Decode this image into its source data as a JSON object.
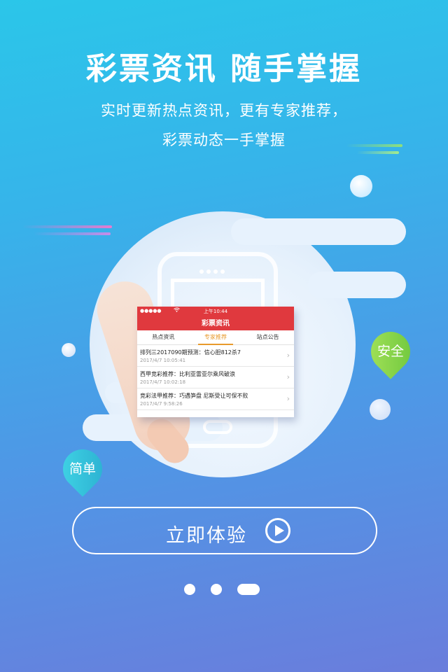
{
  "header": {
    "headline": "彩票资讯  随手掌握",
    "subtitle_line1": "实时更新热点资讯，更有专家推荐，",
    "subtitle_line2": "彩票动态一手掌握"
  },
  "mock_app": {
    "status_signal": "●●●●●",
    "status_wifi": "wifi-icon",
    "status_time": "上午10:44",
    "title": "彩票资讯",
    "tabs": [
      {
        "label": "热点资讯",
        "active": false
      },
      {
        "label": "专家推荐",
        "active": true
      },
      {
        "label": "站点公告",
        "active": false
      }
    ],
    "articles": [
      {
        "title": "排列三2017090期预测：信心胆812杀7",
        "date": "2017/4/7 10:05:41"
      },
      {
        "title": "西甲竞彩推荐：比利亚雷亚尔乘风破浪",
        "date": "2017/4/7 10:02:18"
      },
      {
        "title": "竞彩法甲推荐：巧遇笋盘 尼斯受让可保不败",
        "date": "2017/4/7 9:58:26"
      }
    ]
  },
  "pins": {
    "safe": "安全",
    "simple": "简单"
  },
  "cta": {
    "label": "立即体验",
    "icon": "play-icon"
  },
  "pagination": {
    "total": 3,
    "current": 3
  },
  "colors": {
    "app_red": "#e0393e",
    "tab_active": "#e89a2c",
    "pin_green": "#8bd34a",
    "pin_teal": "#35c8d8"
  }
}
